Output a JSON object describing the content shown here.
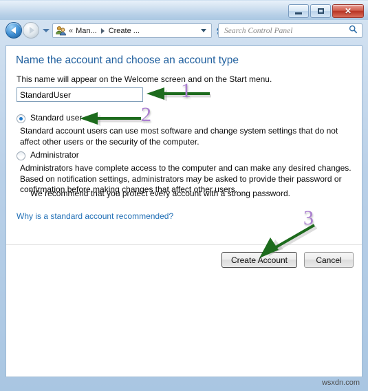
{
  "window": {
    "controls": {
      "minimize_label": "Minimize",
      "maximize_label": "Maximize",
      "close_label": "✕"
    }
  },
  "toolbar": {
    "back_label": "Back",
    "forward_label": "Forward",
    "recent_pages_label": "Recent pages",
    "breadcrumb": {
      "overflow": "«",
      "items": [
        {
          "label": "Man..."
        },
        {
          "label": "Create ..."
        }
      ]
    },
    "address_dropdown_label": "Previous locations",
    "refresh_label": "Refresh",
    "search": {
      "placeholder": "Search Control Panel",
      "value": ""
    }
  },
  "page": {
    "heading": "Name the account and choose an account type",
    "subtext": "This name will appear on the Welcome screen and on the Start menu.",
    "account_name": {
      "value": "StandardUser",
      "placeholder": ""
    },
    "account_types": [
      {
        "id": "standard",
        "label": "Standard user",
        "selected": true,
        "description": "Standard account users can use most software and change system settings that do not affect other users or the security of the computer."
      },
      {
        "id": "administrator",
        "label": "Administrator",
        "selected": false,
        "description": "Administrators have complete access to the computer and can make any desired changes. Based on notification settings, administrators may be asked to provide their password or confirmation before making changes that affect other users."
      }
    ],
    "recommendation": "We recommend that you protect every account with a strong password.",
    "help_link": "Why is a standard account recommended?",
    "buttons": {
      "create": "Create Account",
      "cancel": "Cancel"
    }
  },
  "annotations": {
    "color_number": "#ab7fd0",
    "color_arrow": "#1d6b1d",
    "items": [
      {
        "number": "1",
        "target": "account-name-input"
      },
      {
        "number": "2",
        "target": "standard-user-radio"
      },
      {
        "number": "3",
        "target": "create-account-button"
      }
    ]
  },
  "watermark": "wsxdn.com"
}
